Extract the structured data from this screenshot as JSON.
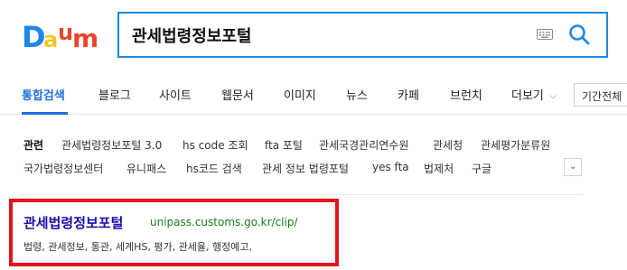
{
  "logo": {
    "letters": [
      "D",
      "a",
      "u",
      "m"
    ],
    "colors": [
      "#1e88e5",
      "#f2c523",
      "#e8452c",
      "#e8452c"
    ]
  },
  "search": {
    "query": "관세법령정보포털"
  },
  "tabs": [
    {
      "label": "통합검색",
      "active": true
    },
    {
      "label": "블로그"
    },
    {
      "label": "사이트"
    },
    {
      "label": "웹문서"
    },
    {
      "label": "이미지"
    },
    {
      "label": "뉴스"
    },
    {
      "label": "카페"
    },
    {
      "label": "브런치"
    },
    {
      "label": "더보기"
    }
  ],
  "period_label": "기간전체",
  "related": {
    "label": "관련",
    "items": [
      "관세법령정보포털 3.0",
      "hs code 조회",
      "fta 포털",
      "관세국경관리연수원",
      "관세청",
      "관세평가분류원",
      "국가법령정보센터",
      "유니패스",
      "hs코드 검색",
      "관세 정보 법령포털",
      "yes fta",
      "법제처",
      "구글"
    ]
  },
  "result": {
    "title": "관세법령정보포털",
    "url": "unipass.customs.go.kr/clip/",
    "description": "법령, 관세정보, 통관, 세계HS, 평가, 관세율, 행정예고,"
  },
  "colors": {
    "accent": "#1e6fe0",
    "link": "#1a0dab",
    "url": "#1b7a1b",
    "highlight": "#e8121a"
  }
}
